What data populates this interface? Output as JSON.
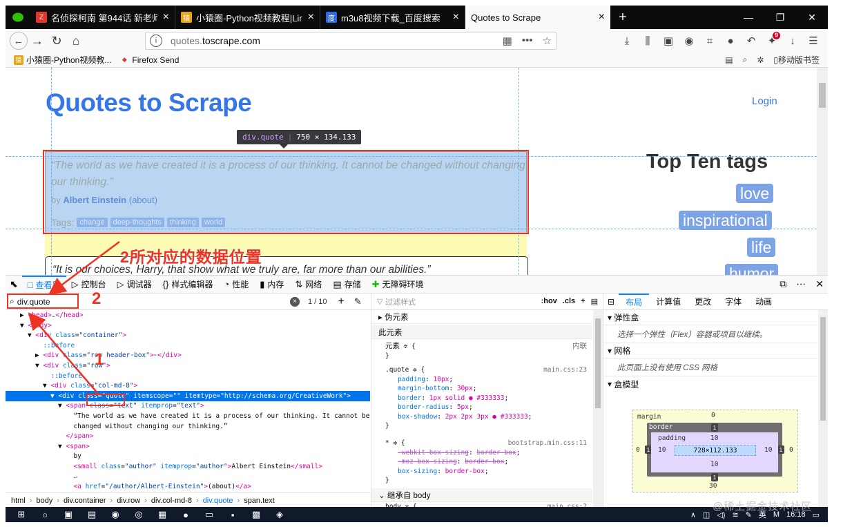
{
  "tabs": [
    {
      "title": "名侦探柯南 第944话 新老师的",
      "icon_color": "#e3372c"
    },
    {
      "title": "小猿圈-Python视频教程|Linux",
      "icon_color": "#e7a414"
    },
    {
      "title": "m3u8视频下载_百度搜索",
      "icon_color": "#2d6be4"
    },
    {
      "title": "Quotes to Scrape",
      "icon_color": ""
    }
  ],
  "url": {
    "prefix": "quotes.",
    "domain": "toscrape.com"
  },
  "bookmarks": [
    {
      "label": "小猿圈-Python视频教...",
      "icon": "猿",
      "color": "#e7a414"
    },
    {
      "label": "Firefox Send",
      "icon": "◆",
      "color": "#e3372c"
    }
  ],
  "bookmarks_right": "移动版书签",
  "badge_count": "9",
  "page": {
    "logo": "Quotes to Scrape",
    "login": "Login",
    "tags_title": "Top Ten tags",
    "tags": [
      "love",
      "inspirational",
      "life",
      "humor"
    ],
    "quote1": "“The world as we have created it is a process of our thinking. It cannot be changed without changing our thinking.”",
    "by": "by",
    "author": "Albert Einstein",
    "about": "(about)",
    "tags_label": "Tags:",
    "quote_tags": [
      "change",
      "deep-thoughts",
      "thinking",
      "world"
    ],
    "quote2": "“It is our choices, Harry, that show what we truly are, far more than our abilities.”",
    "tooltip_tag": "div.quote",
    "tooltip_size": "750 × 134.133"
  },
  "annotations": {
    "label_2_text": "2所对应的数据位置",
    "num_1": "1",
    "num_2": "2"
  },
  "devtools": {
    "tabs": [
      {
        "label": "查看器",
        "icon": "□"
      },
      {
        "label": "控制台",
        "icon": "▷"
      },
      {
        "label": "调试器",
        "icon": "▷"
      },
      {
        "label": "样式编辑器",
        "icon": "{}"
      },
      {
        "label": "性能",
        "icon": "◔"
      },
      {
        "label": "内存",
        "icon": "▮"
      },
      {
        "label": "网络",
        "icon": "⇅"
      },
      {
        "label": "存储",
        "icon": "▤"
      },
      {
        "label": "无障碍环境",
        "icon": "✚"
      }
    ],
    "search_value": "div.quote",
    "search_counter": "1 / 10",
    "breadcrumbs": [
      "html",
      "body",
      "div.container",
      "div.row",
      "div.col-md-8",
      "div.quote",
      "span.text"
    ],
    "rules_filter_placeholder": "过滤样式",
    "rules_tools": [
      ":hov",
      ".cls",
      "+"
    ],
    "pseudo": "伪元素",
    "this_element": "此元素",
    "element_rule": "元素",
    "inline": "内联",
    "quote_sel": ".quote",
    "main_css": "main.css:23",
    "props": [
      {
        "p": "padding",
        "v": "10px"
      },
      {
        "p": "margin-bottom",
        "v": "30px"
      },
      {
        "p": "border",
        "v": "1px solid ● #333333"
      },
      {
        "p": "border-radius",
        "v": "5px"
      },
      {
        "p": "box-shadow",
        "v": "2px 2px 3px ● #333333"
      }
    ],
    "star_sel": "*",
    "bootstrap": "bootstrap.min.css:11",
    "star_props": [
      {
        "p": "-webkit-box-sizing",
        "v": "border-box",
        "s": true
      },
      {
        "p": "-moz-box-sizing",
        "v": "border-box",
        "s": true
      },
      {
        "p": "box-sizing",
        "v": "border-box",
        "s": false
      }
    ],
    "inherit": "继承自 body",
    "body_sel": "body",
    "main_css2": "main.css:2",
    "layout_tabs": [
      "布局",
      "计算值",
      "更改",
      "字体",
      "动画"
    ],
    "flex_head": "弹性盒",
    "flex_note": "选择一个弹性（Flex）容器或项目以继续。",
    "grid_head": "网格",
    "grid_note": "此页面上没有使用 CSS 网格",
    "boxmodel_head": "盒模型",
    "bm": {
      "margin": "margin",
      "border": "border",
      "padding": "padding",
      "content": "728×112.133",
      "m_top": "0",
      "m_bottom": "30",
      "m_left": "0",
      "m_right": "0",
      "b": "1",
      "p": "10"
    }
  },
  "tree": [
    {
      "indent": 1,
      "html": "▶ <span class='tg'>&lt;head&gt;</span><span class='tw'>…</span><span class='tg'>&lt;/head&gt;</span>"
    },
    {
      "indent": 1,
      "html": "▼ <span class='tg'>&lt;body&gt;</span>"
    },
    {
      "indent": 2,
      "html": "▼ <span class='tg'>&lt;div</span> <span class='at'>class</span>=<span class='av'>\"container\"</span><span class='tg'>&gt;</span>"
    },
    {
      "indent": 3,
      "html": "  <span class='pe'>::before</span>"
    },
    {
      "indent": 3,
      "html": "▶ <span class='tg'>&lt;div</span> <span class='at'>class</span>=<span class='av'>\"row header-box\"</span><span class='tg'>&gt;</span><span class='tw'>⋯</span><span class='tg'>&lt;/div&gt;</span>"
    },
    {
      "indent": 3,
      "html": "▼ <span class='tg'>&lt;div</span> <span class='at'>class</span>=<span class='av'>\"row\"</span><span class='tg'>&gt;</span>"
    },
    {
      "indent": 4,
      "html": "  <span class='pe'>::before</span>"
    },
    {
      "indent": 4,
      "html": "▼ <span class='tg'>&lt;div</span> <span class='at'>class</span>=<span class='av'>\"col-md-8\"</span><span class='tg'>&gt;</span>"
    },
    {
      "indent": 5,
      "html": "▼ <span class='tg'>&lt;div</span> <span class='at'>class</span>=<span class='av'>\"quote\"</span> <span class='at'>itemscope</span>=<span class='av'>\"\"</span> <span class='at'>itemtype</span>=<span class='av'>\"http://schema.org/CreativeWork\"</span><span class='tg'>&gt;</span>",
      "hl": true
    },
    {
      "indent": 6,
      "html": "▼ <span class='tg'>&lt;span</span> <span class='at'>class</span>=<span class='av'>\"text\"</span> <span class='at'>itemprop</span>=<span class='av'>\"text\"</span><span class='tg'>&gt;</span>"
    },
    {
      "indent": 7,
      "html": "  <span class='tx'>“The world as we have created it is a process of our thinking. It cannot be</span>"
    },
    {
      "indent": 7,
      "html": "  <span class='tx'>changed without changing our thinking.”</span>"
    },
    {
      "indent": 6,
      "html": "  <span class='tg'>&lt;/span&gt;</span>"
    },
    {
      "indent": 6,
      "html": "▼ <span class='tg'>&lt;span&gt;</span>"
    },
    {
      "indent": 7,
      "html": "  <span class='tx'>by</span>"
    },
    {
      "indent": 7,
      "html": "  <span class='tg'>&lt;small</span> <span class='at'>class</span>=<span class='av'>\"author\"</span> <span class='at'>itemprop</span>=<span class='av'>\"author\"</span><span class='tg'>&gt;</span><span class='tx'>Albert Einstein</span><span class='tg'>&lt;/small&gt;</span>"
    },
    {
      "indent": 7,
      "html": "  <span class='tw'>↵</span>"
    },
    {
      "indent": 7,
      "html": "  <span class='tg'>&lt;a</span> <span class='at'>href</span>=<span class='av'>\"/author/Albert-Einstein\"</span><span class='tg'>&gt;</span><span class='tx'>(about)</span><span class='tg'>&lt;/a&gt;</span>"
    }
  ],
  "taskbar": {
    "icons": [
      "⊞",
      "○",
      "▣",
      "▤",
      "◉",
      "◎",
      "▦",
      "●",
      "▭",
      "▪",
      "▩",
      "◈"
    ],
    "clock": "16:18",
    "ime": "英"
  },
  "watermark": "@稀土掘金技术社区",
  "colors": {
    "accent": "#0a84ff",
    "annotation": "#ee3322",
    "link": "#3677e8",
    "highlight": "#bad5f2"
  }
}
